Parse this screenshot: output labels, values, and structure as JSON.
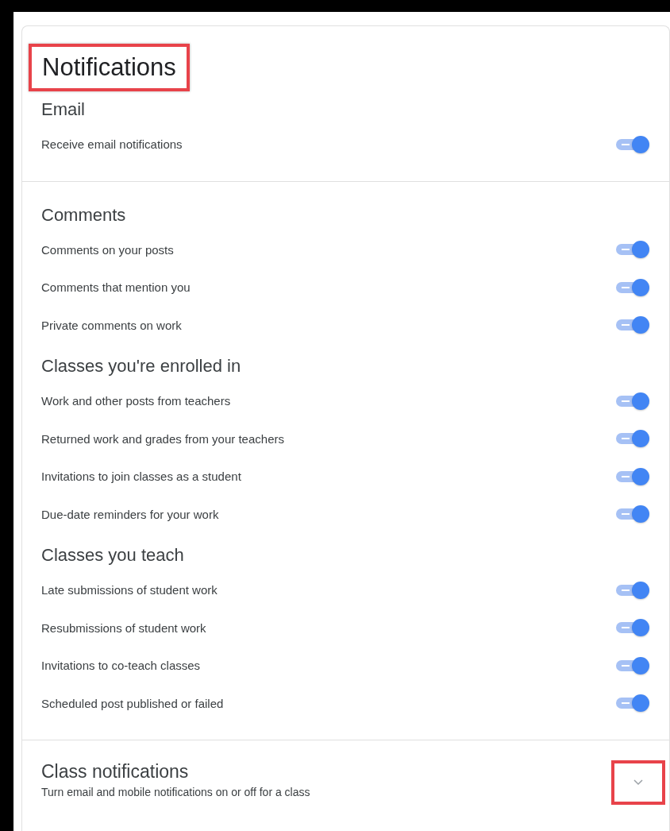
{
  "title": {
    "text": "Notifications",
    "highlighted": true
  },
  "sections": [
    {
      "groups": [
        {
          "heading": "Email",
          "items": [
            {
              "label": "Receive email notifications",
              "on": true
            }
          ]
        }
      ]
    },
    {
      "groups": [
        {
          "heading": "Comments",
          "items": [
            {
              "label": "Comments on your posts",
              "on": true
            },
            {
              "label": "Comments that mention you",
              "on": true
            },
            {
              "label": "Private comments on work",
              "on": true
            }
          ]
        },
        {
          "heading": "Classes you're enrolled in",
          "items": [
            {
              "label": "Work and other posts from teachers",
              "on": true
            },
            {
              "label": "Returned work and grades from your teachers",
              "on": true
            },
            {
              "label": "Invitations to join classes as a student",
              "on": true
            },
            {
              "label": "Due-date reminders for your work",
              "on": true
            }
          ]
        },
        {
          "heading": "Classes you teach",
          "items": [
            {
              "label": "Late submissions of student work",
              "on": true
            },
            {
              "label": "Resubmissions of student work",
              "on": true
            },
            {
              "label": "Invitations to co-teach classes",
              "on": true
            },
            {
              "label": "Scheduled post published or failed",
              "on": true
            }
          ]
        }
      ]
    }
  ],
  "class_notifications": {
    "heading": "Class notifications",
    "description": "Turn email and mobile notifications on or off for a class",
    "expanded": false,
    "highlighted": true
  }
}
